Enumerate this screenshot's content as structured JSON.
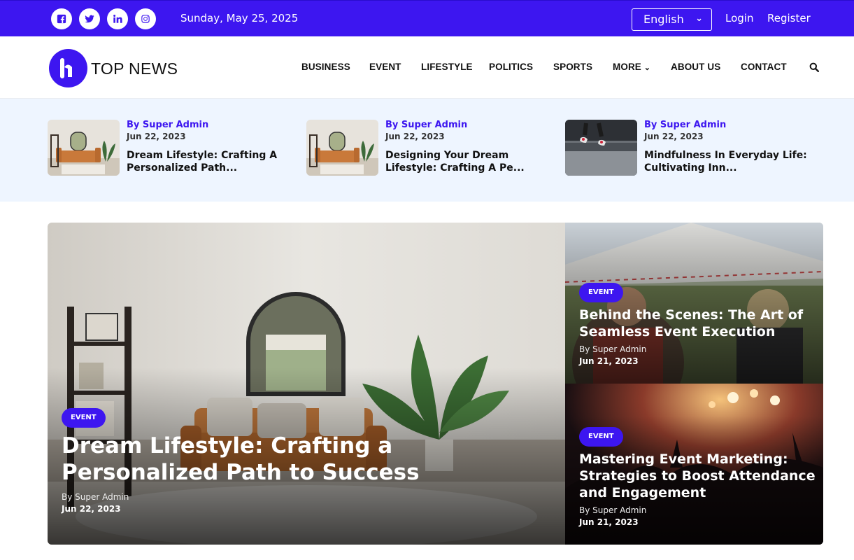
{
  "topbar": {
    "date": "Sunday, May 25, 2025",
    "language": "English",
    "login": "Login",
    "register": "Register",
    "social": [
      "facebook-icon",
      "twitter-icon",
      "linkedin-icon",
      "instagram-icon"
    ]
  },
  "brand": {
    "name": "TOP NEWS",
    "accent": "#3d16f0"
  },
  "nav": {
    "items": [
      "BUSINESS",
      "EVENT",
      "LIFESTYLE",
      "POLITICS",
      "SPORTS",
      "MORE",
      "ABOUT US",
      "CONTACT"
    ]
  },
  "ticker": [
    {
      "author": "By Super Admin",
      "date": "Jun 22, 2023",
      "title": "Dream Lifestyle: Crafting A Personalized Path..."
    },
    {
      "author": "By Super Admin",
      "date": "Jun 22, 2023",
      "title": "Designing Your Dream Lifestyle: Crafting A Pe..."
    },
    {
      "author": "By Super Admin",
      "date": "Jun 22, 2023",
      "title": "Mindfulness In Everyday Life: Cultivating Inn..."
    }
  ],
  "featured": {
    "main": {
      "category": "EVENT",
      "title": "Dream Lifestyle: Crafting a Personalized Path to Success",
      "author": "By Super Admin",
      "date": "Jun 22, 2023"
    },
    "side": [
      {
        "category": "EVENT",
        "title": "Behind the Scenes: The Art of Seamless Event Execution",
        "author": "By Super Admin",
        "date": "Jun 21, 2023"
      },
      {
        "category": "EVENT",
        "title": "Mastering Event Marketing: Strategies to Boost Attendance and Engagement",
        "author": "By Super Admin",
        "date": "Jun 21, 2023"
      }
    ]
  }
}
